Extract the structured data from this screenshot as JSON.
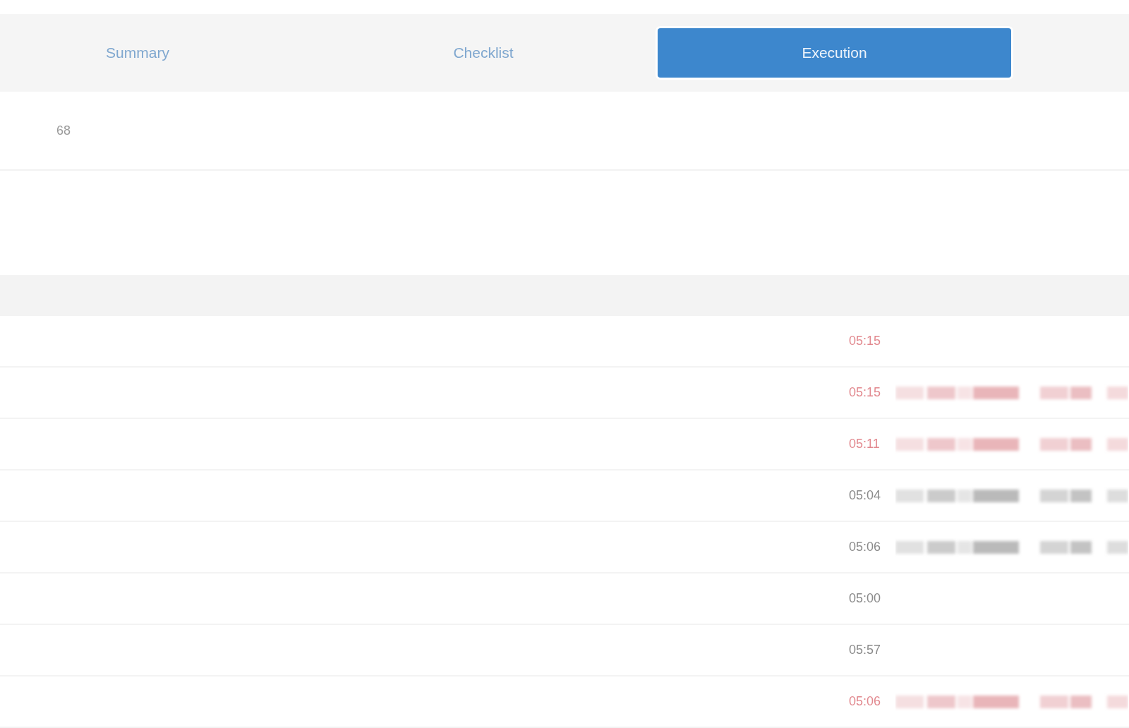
{
  "tabs": [
    {
      "label": "Summary",
      "selected": false
    },
    {
      "label": "Checklist",
      "selected": false
    },
    {
      "label": "Execution",
      "selected": true
    }
  ],
  "toolbar": {
    "count": "68"
  },
  "rows": [
    {
      "time": "05:15",
      "late": true,
      "blurred_text": false
    },
    {
      "time": "05:15",
      "late": true,
      "blurred_text": true
    },
    {
      "time": "05:11",
      "late": true,
      "blurred_text": true
    },
    {
      "time": "05:04",
      "late": false,
      "blurred_text": true
    },
    {
      "time": "05:06",
      "late": false,
      "blurred_text": true
    },
    {
      "time": "05:00",
      "late": false,
      "blurred_text": false
    },
    {
      "time": "05:57",
      "late": false,
      "blurred_text": false
    },
    {
      "time": "05:06",
      "late": true,
      "blurred_text": true
    }
  ]
}
